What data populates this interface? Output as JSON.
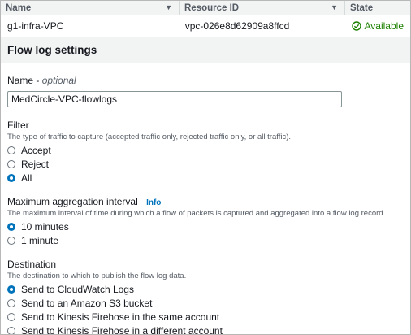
{
  "table": {
    "columns": [
      {
        "label": "Name"
      },
      {
        "label": "Resource ID"
      },
      {
        "label": "State"
      }
    ],
    "row": {
      "name": "g1-infra-VPC",
      "resource_id": "vpc-026e8d62909a8ffcd",
      "state": "Available",
      "state_color": "#1d8102"
    }
  },
  "section_title": "Flow log settings",
  "name_field": {
    "label": "Name",
    "optional": "optional",
    "separator": " - ",
    "value": "MedCircle-VPC-flowlogs"
  },
  "filter": {
    "label": "Filter",
    "description": "The type of traffic to capture (accepted traffic only, rejected traffic only, or all traffic).",
    "options": [
      "Accept",
      "Reject",
      "All"
    ],
    "selected": "All"
  },
  "aggregation": {
    "label": "Maximum aggregation interval",
    "info": "Info",
    "description": "The maximum interval of time during which a flow of packets is captured and aggregated into a flow log record.",
    "options": [
      "10 minutes",
      "1 minute"
    ],
    "selected": "10 minutes"
  },
  "destination": {
    "label": "Destination",
    "description": "The destination to which to publish the flow log data.",
    "options": [
      "Send to CloudWatch Logs",
      "Send to an Amazon S3 bucket",
      "Send to Kinesis Firehose in the same account",
      "Send to Kinesis Firehose in a different account"
    ],
    "selected": "Send to CloudWatch Logs"
  },
  "colors": {
    "accent": "#0073bb",
    "success": "#1d8102",
    "header_bg": "#f2f3f3"
  }
}
